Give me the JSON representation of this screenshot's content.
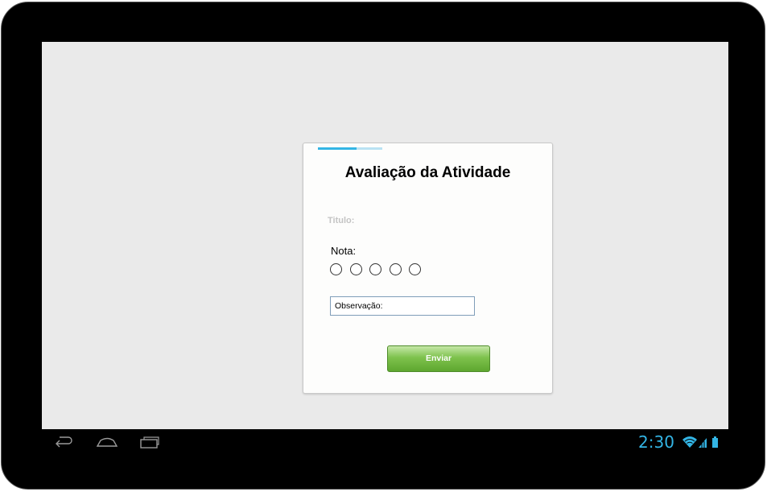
{
  "dialog": {
    "progress": 0.6,
    "title": "Avaliação da Atividade",
    "titulo_label": "Titulo:",
    "nota_label": "Nota:",
    "rating_options": 5,
    "observacao_placeholder": "Observação:",
    "submit_label": "Enviar"
  },
  "status_bar": {
    "time": "2:30"
  },
  "colors": {
    "accent": "#33b5e5",
    "button": "#6cb43c",
    "screen_bg": "#eaeaea"
  }
}
